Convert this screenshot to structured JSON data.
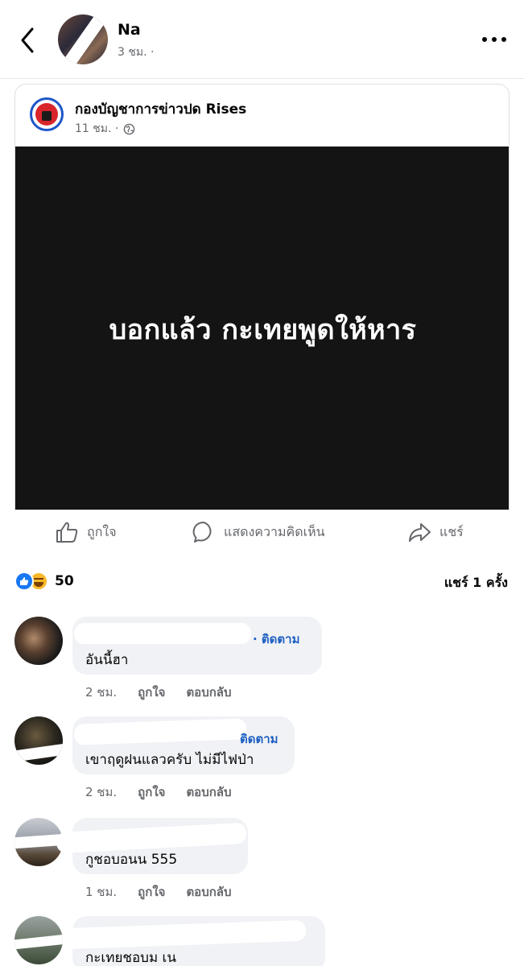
{
  "header": {
    "author_name": "Na",
    "time": "3 ชม. ·"
  },
  "shared_post": {
    "page_name": "กองบัญชาการข่าวปด Rises",
    "time": "11 ชม. ·",
    "image_text": "บอกแล้ว กะเทยพูดให้หาร"
  },
  "actions": {
    "like_label": "ถูกใจ",
    "comment_label": "แสดงความคิดเห็น",
    "share_label": "แชร์"
  },
  "reactions": {
    "count": "50",
    "shares": "แชร์ 1 ครั้ง"
  },
  "comments": [
    {
      "follow": "· ติดตาม",
      "text": "อันนี้ฮา",
      "time": "2 ชม.",
      "like": "ถูกใจ",
      "reply": "ตอบกลับ"
    },
    {
      "follow": "ติดตาม",
      "text": "เขาฤดูฝนแลวครับ ไม่มีไฟป่า",
      "time": "2 ชม.",
      "like": "ถูกใจ",
      "reply": "ตอบกลับ"
    },
    {
      "follow": "",
      "text": "กูชอบอนน 555",
      "time": "1 ชม.",
      "like": "ถูกใจ",
      "reply": "ตอบกลับ"
    },
    {
      "follow": "",
      "text": "กะเทยชอบม เน",
      "time": "",
      "like": "",
      "reply": ""
    }
  ],
  "colors": {
    "accent_blue": "#1877f2",
    "link_blue": "#1d5fc2",
    "muted_text": "#65676b",
    "bubble_bg": "#f0f2f5",
    "image_bg": "#141414"
  }
}
